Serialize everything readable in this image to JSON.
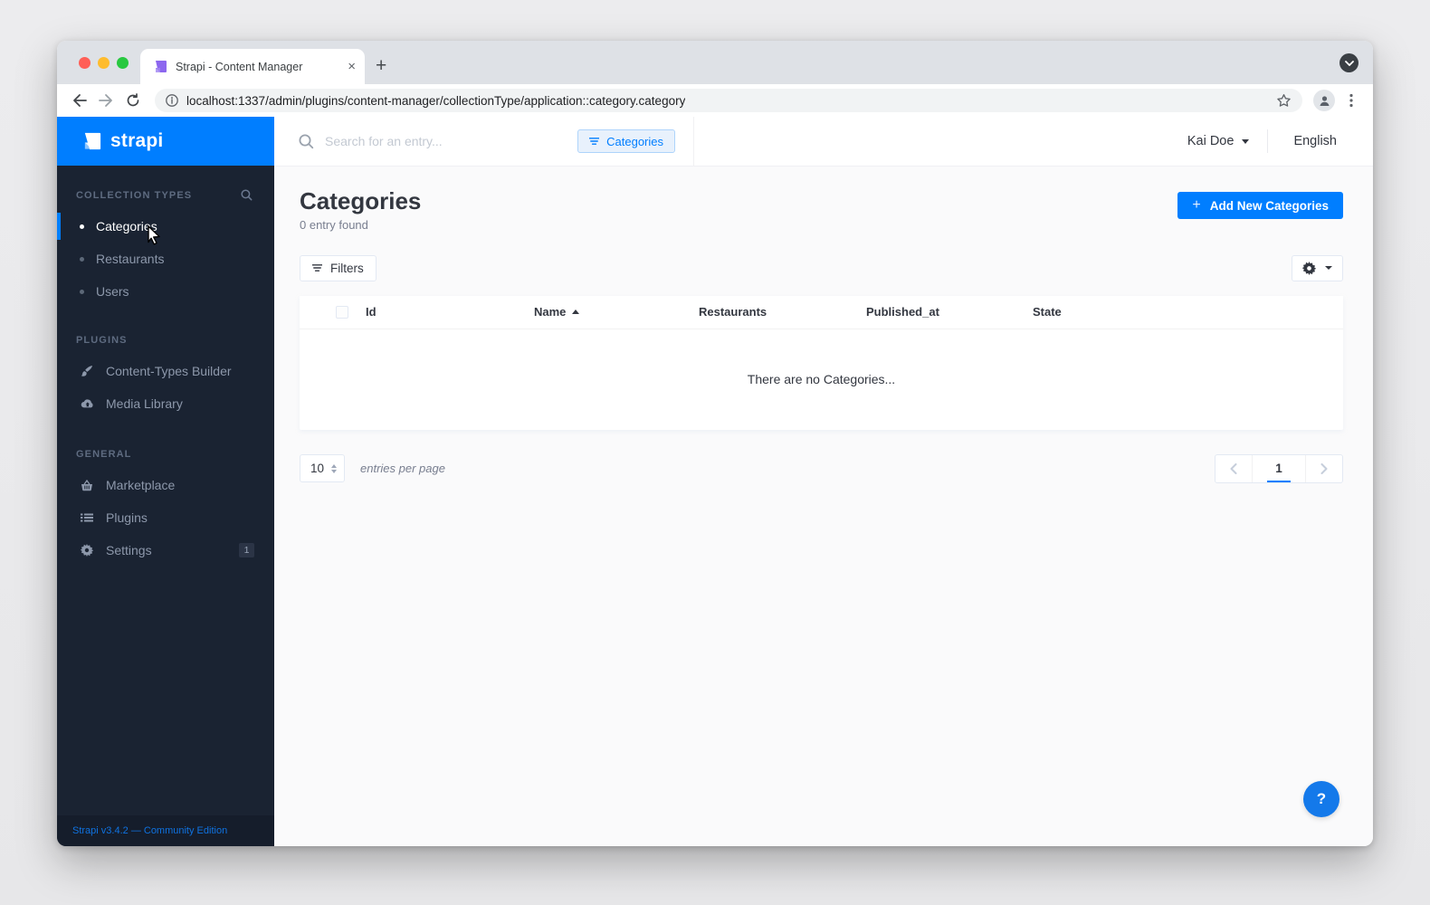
{
  "browser": {
    "tab_title": "Strapi - Content Manager",
    "url": "localhost:1337/admin/plugins/content-manager/collectionType/application::category.category",
    "close_tab": "×",
    "new_tab": "+"
  },
  "sidebar": {
    "logo_text": "strapi",
    "sections": [
      {
        "label": "COLLECTION TYPES",
        "items": [
          {
            "label": "Categories"
          },
          {
            "label": "Restaurants"
          },
          {
            "label": "Users"
          }
        ]
      },
      {
        "label": "PLUGINS",
        "items": [
          {
            "label": "Content-Types Builder"
          },
          {
            "label": "Media Library"
          }
        ]
      },
      {
        "label": "GENERAL",
        "items": [
          {
            "label": "Marketplace"
          },
          {
            "label": "Plugins"
          },
          {
            "label": "Settings",
            "badge": "1"
          }
        ]
      }
    ],
    "footer": "Strapi v3.4.2 — Community Edition"
  },
  "header": {
    "search_placeholder": "Search for an entry...",
    "filter_chip": "Categories",
    "user_name": "Kai Doe",
    "language": "English"
  },
  "main": {
    "title": "Categories",
    "subtitle": "0 entry found",
    "add_button": "Add New Categories",
    "add_plus": "+",
    "filters_button": "Filters",
    "table": {
      "columns": [
        "Id",
        "Name",
        "Restaurants",
        "Published_at",
        "State"
      ],
      "sorted_column": "Name",
      "sort_direction": "asc",
      "empty_message": "There are no Categories...",
      "rows": []
    },
    "pagination": {
      "entries_per_page_value": "10",
      "entries_per_page_label": "entries per page",
      "current_page": "1"
    },
    "help_label": "?"
  },
  "colors": {
    "brand_blue": "#007eff",
    "sidebar_dark": "#1a2332",
    "main_bg": "#fafafb",
    "text_dark": "#333740",
    "text_muted": "#787e8f"
  }
}
